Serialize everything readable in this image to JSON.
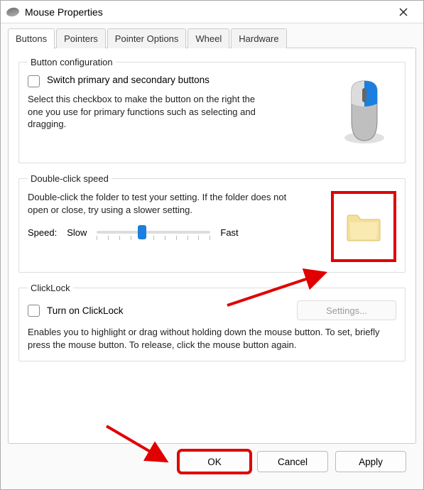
{
  "window": {
    "title": "Mouse Properties"
  },
  "tabs": {
    "items": [
      {
        "label": "Buttons"
      },
      {
        "label": "Pointers"
      },
      {
        "label": "Pointer Options"
      },
      {
        "label": "Wheel"
      },
      {
        "label": "Hardware"
      }
    ],
    "active_index": 0
  },
  "button_config": {
    "legend": "Button configuration",
    "switch_label": "Switch primary and secondary buttons",
    "switch_checked": false,
    "description": "Select this checkbox to make the button on the right the one you use for primary functions such as selecting and dragging."
  },
  "double_click": {
    "legend": "Double-click speed",
    "description": "Double-click the folder to test your setting. If the folder does not open or close, try using a slower setting.",
    "speed_label": "Speed:",
    "slow_label": "Slow",
    "fast_label": "Fast",
    "slider_position_pct": 40
  },
  "clicklock": {
    "legend": "ClickLock",
    "turn_on_label": "Turn on ClickLock",
    "turn_on_checked": false,
    "settings_label": "Settings...",
    "settings_enabled": false,
    "description": "Enables you to highlight or drag without holding down the mouse button. To set, briefly press the mouse button. To release, click the mouse button again."
  },
  "dialog_buttons": {
    "ok": "OK",
    "cancel": "Cancel",
    "apply": "Apply"
  },
  "annotations": {
    "arrow_to_folder": true,
    "arrow_to_ok": true,
    "folder_highlighted": true,
    "ok_highlighted": true,
    "color": "#e00000"
  }
}
